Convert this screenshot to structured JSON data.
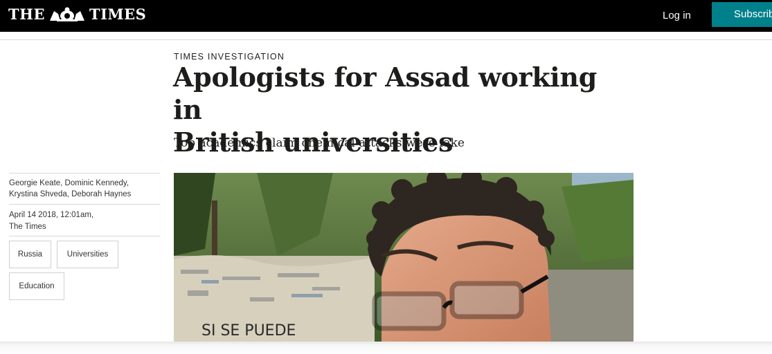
{
  "header": {
    "logo_left": "THE",
    "logo_right": "TIMES",
    "login_label": "Log in",
    "subscribe_label": "Subscribe"
  },
  "article": {
    "section": "TIMES INVESTIGATION",
    "headline_line1": "Apologists for Assad working in",
    "headline_line2": "British universities",
    "standfirst": "Top academics claim chemical attacks were fake",
    "authors_line1": "Georgie Keate, Dominic Kennedy,",
    "authors_line2": "Krystina Shveda, Deborah Haynes",
    "date": "April 14 2018, 12:01am,",
    "publication": "The Times",
    "tags": [
      "Russia",
      "Universities",
      "Education"
    ],
    "photo_sign_text": "SI SE PUEDE"
  },
  "colors": {
    "topbar": "#000000",
    "subscribe": "#00808a",
    "text": "#1d1d1b"
  }
}
